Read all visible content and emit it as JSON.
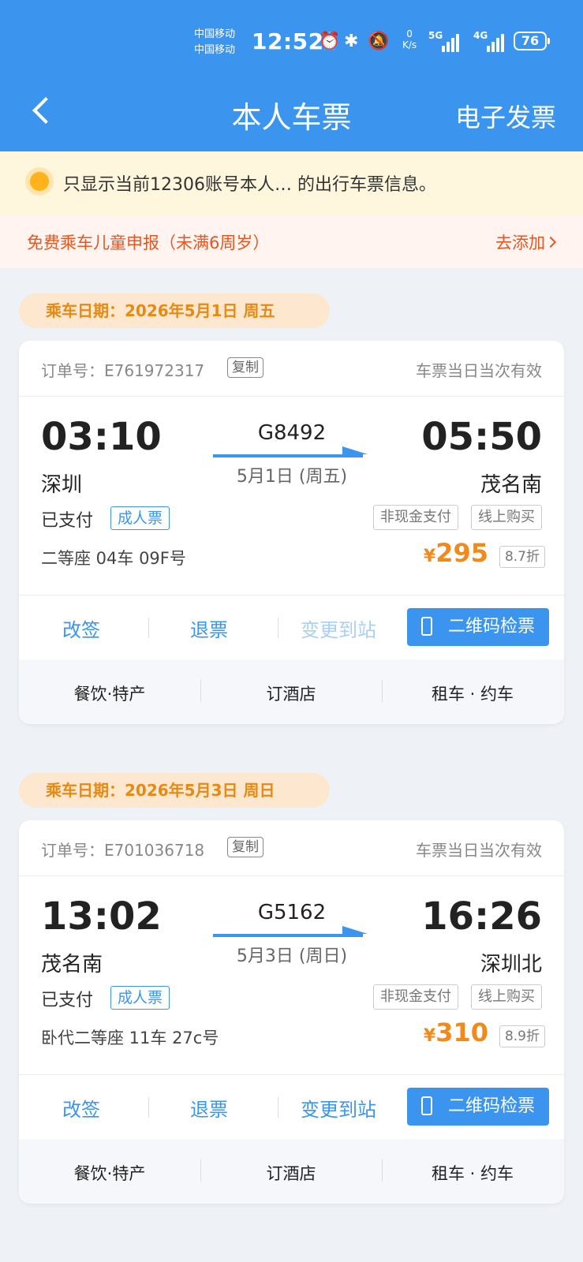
{
  "status_bar": {
    "carrier_1": "中国移动",
    "carrier_2": "中国移动",
    "time": "12:52",
    "speed_value": "0",
    "speed_unit": "K/s",
    "net_1": "5G",
    "net_2": "4G",
    "battery": "76"
  },
  "header": {
    "title": "本人车票",
    "right_action": "电子发票",
    "back_icon": "chevron-left-icon"
  },
  "notice": {
    "text": "只显示当前12306账号本人… 的出行车票信息。"
  },
  "child_banner": {
    "text": "免费乘车儿童申报（未满6周岁）",
    "link": "去添加"
  },
  "tickets": [
    {
      "date_label": "乘车日期：2026年5月1日 周五",
      "order_label": "订单号：E761972317",
      "copy_label": "复制",
      "validity": "车票当日当次有效",
      "dep_time": "03:10",
      "dep_station": "深圳",
      "train_no": "G8492",
      "train_date": "5月1日 (周五)",
      "arr_time": "05:50",
      "arr_station": "茂名南",
      "paid": "已支付",
      "ticket_type": "成人票",
      "tag1": "非现金支付",
      "tag2": "线上购买",
      "seat": "二等座 04车 09F号",
      "currency": "¥",
      "price": "295",
      "discount": "8.7折",
      "actions": {
        "change": "改签",
        "refund": "退票",
        "change_station": "变更到站",
        "qr": "二维码检票"
      },
      "services": {
        "food": "餐饮·特产",
        "hotel": "订酒店",
        "car": "租车 · 约车"
      }
    },
    {
      "date_label": "乘车日期：2026年5月3日 周日",
      "order_label": "订单号：E701036718",
      "copy_label": "复制",
      "validity": "车票当日当次有效",
      "dep_time": "13:02",
      "dep_station": "茂名南",
      "train_no": "G5162",
      "train_date": "5月3日 (周日)",
      "arr_time": "16:26",
      "arr_station": "深圳北",
      "paid": "已支付",
      "ticket_type": "成人票",
      "tag1": "非现金支付",
      "tag2": "线上购买",
      "seat": "卧代二等座 11车 27c号",
      "currency": "¥",
      "price": "310",
      "discount": "8.9折",
      "actions": {
        "change": "改签",
        "refund": "退票",
        "change_station": "变更到站",
        "qr": "二维码检票"
      },
      "services": {
        "food": "餐饮·特产",
        "hotel": "订酒店",
        "car": "租车 · 约车"
      }
    }
  ],
  "colors": {
    "primary": "#3b95ef",
    "price": "#f08a1c",
    "child_text": "#e8551f"
  }
}
